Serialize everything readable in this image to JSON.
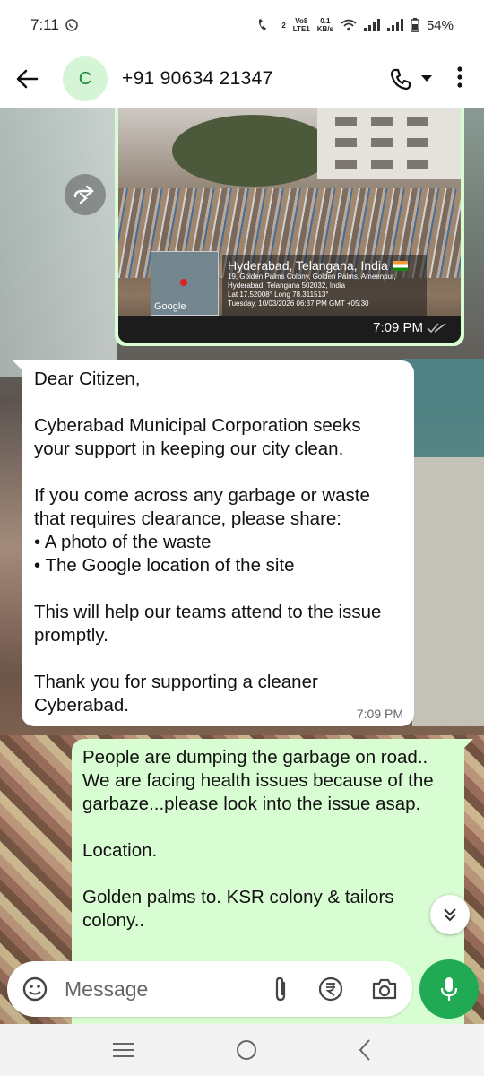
{
  "status_bar": {
    "time": "7:11",
    "net_top": "Vo8",
    "net_bottom": "LTE1",
    "speed_top": "0.1",
    "speed_bottom": "KB/s",
    "sim_index": "2",
    "battery": "54%"
  },
  "header": {
    "avatar_letter": "C",
    "contact": "+91 90634 21347"
  },
  "image_message": {
    "geo_title": "Hyderabad, Telangana, India",
    "geo_address_1": "19, Golden Palms Colony, Golden Palms, Ameenpur,",
    "geo_address_2": "Hyderabad, Telangana 502032, India",
    "geo_latlong": "Lat 17.52008° Long 78.311513°",
    "geo_datetime": "Tuesday, 10/03/2026 06:37 PM GMT +05:30",
    "map_label": "Google",
    "time": "7:09 PM"
  },
  "received_message": {
    "text": "Dear Citizen,\n\nCyberabad Municipal Corporation seeks your support in keeping our city clean.\n\nIf you come across any garbage or waste that requires clearance, please share:\n• A photo of the waste\n• The Google location of the site\n\nThis will help our teams attend to the issue promptly.\n\nThank you for supporting a cleaner Cyberabad.",
    "time": "7:09 PM"
  },
  "sent_message": {
    "text": "People are dumping the garbage on road.. We are facing health issues because of the garbaze...please look into the issue asap.\n\nLocation.\n\nGolden palms to. KSR colony & tailors colony.."
  },
  "composer": {
    "placeholder": "Message"
  },
  "colors": {
    "accent_green": "#1faa53",
    "sent_bubble": "#d9fdd3",
    "avatar_bg": "#d6f5d6"
  },
  "icons": [
    "back-arrow-icon",
    "phone-icon",
    "dropdown-icon",
    "more-icon",
    "forward-icon",
    "read-ticks-icon",
    "chevrons-down-icon",
    "sticker-icon",
    "attach-icon",
    "rupee-icon",
    "camera-icon",
    "mic-icon",
    "recents-icon",
    "home-icon",
    "back-nav-icon"
  ]
}
